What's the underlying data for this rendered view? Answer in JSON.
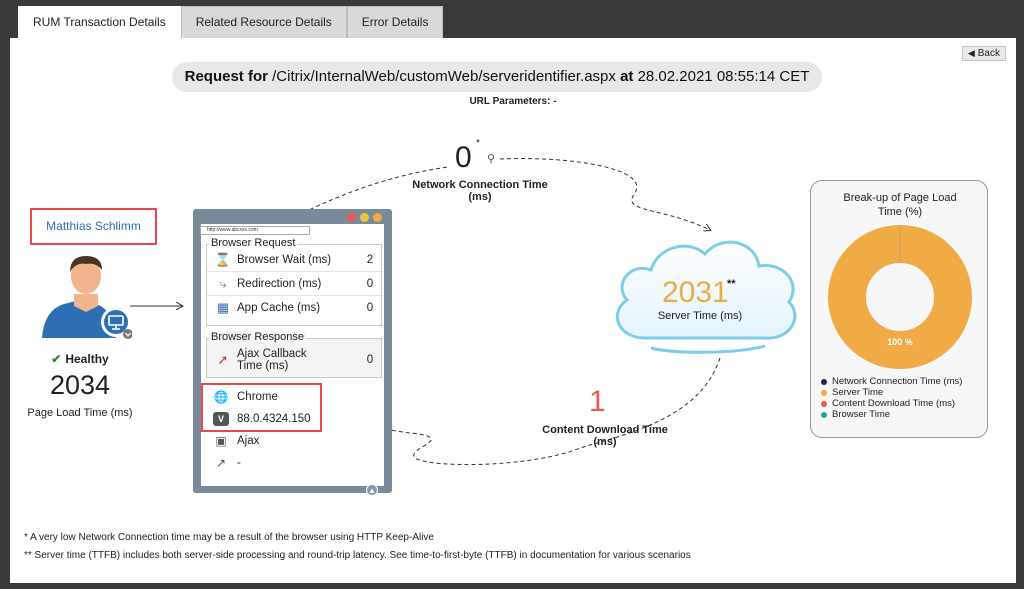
{
  "tabs": [
    "RUM Transaction Details",
    "Related Resource Details",
    "Error Details"
  ],
  "back_label": "Back",
  "request": {
    "prefix": "Request for",
    "path": "/Citrix/InternalWeb/customWeb/serveridentifier.aspx",
    "at": "at",
    "timestamp": "28.02.2021 08:55:14 CET",
    "url_params": "URL Parameters: -"
  },
  "user": {
    "name": "Matthias Schlimm",
    "status": "Healthy",
    "page_load_time": "2034",
    "page_load_label": "Page Load Time (ms)"
  },
  "browser": {
    "url": "http://www.abcxxx.com",
    "request_group": "Browser Request",
    "request_rows": [
      {
        "icon": "hourglass-icon",
        "label": "Browser Wait (ms)",
        "value": "2"
      },
      {
        "icon": "redirect-arrow-icon",
        "label": "Redirection (ms)",
        "value": "0"
      },
      {
        "icon": "cache-building-icon",
        "label": "App Cache (ms)",
        "value": "0"
      }
    ],
    "response_group": "Browser Response",
    "response_rows": [
      {
        "icon": "ajax-callback-icon",
        "label": "Ajax Callback Time (ms)",
        "value": "0"
      }
    ],
    "browser_name": "Chrome",
    "browser_version": "88.0.4324.150",
    "page_type": "Ajax",
    "extra": "-"
  },
  "metrics": {
    "network_connection_value": "0",
    "network_connection_star": "*",
    "network_connection_label": "Network Connection Time (ms)",
    "server_value": "2031",
    "server_star": "**",
    "server_label": "Server Time (ms)",
    "content_download_value": "1",
    "content_download_label": "Content Download Time (ms)"
  },
  "breakup": {
    "title": "Break-up of Page Load Time (%)",
    "center_label": "100 %",
    "legend": [
      {
        "name": "Network Connection Time (ms)",
        "color": "#1f2a44"
      },
      {
        "name": "Server Time",
        "color": "#f0ab47"
      },
      {
        "name": "Content Download Time (ms)",
        "color": "#e85a4f"
      },
      {
        "name": "Browser Time",
        "color": "#2a9d9d"
      }
    ]
  },
  "chart_data": {
    "type": "pie",
    "title": "Break-up of Page Load Time (%)",
    "categories": [
      "Network Connection Time (ms)",
      "Server Time",
      "Content Download Time (ms)",
      "Browser Time"
    ],
    "values": [
      0,
      100,
      0,
      0
    ],
    "legend": "bottom"
  },
  "footnotes": [
    "* A very low Network Connection time may be a result of the browser using HTTP Keep-Alive",
    "** Server time (TTFB) includes both server-side processing and round-trip latency. See time-to-first-byte (TTFB) in documentation for various scenarios"
  ]
}
